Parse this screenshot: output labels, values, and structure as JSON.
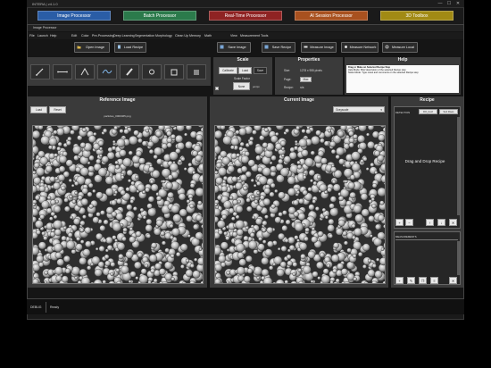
{
  "launcher": {
    "title": "INTERA | v4.1.0",
    "window_controls": [
      "—",
      "☐",
      "✕"
    ],
    "tabs": [
      {
        "label": "Image Processor",
        "color": "#2a5da6"
      },
      {
        "label": "Batch Processor",
        "color": "#2b7a4b"
      },
      {
        "label": "Real-Time Processor",
        "color": "#8f2323"
      },
      {
        "label": "AI Session Processor",
        "color": "#a8511f"
      },
      {
        "label": "3D Toolbox",
        "color": "#a18a14"
      }
    ]
  },
  "app": {
    "title": "Image Processor",
    "menu": [
      "File",
      "Launch",
      "Help",
      "Edit",
      "Color",
      "Pre-Processing",
      "Deep Learning",
      "Segmentation",
      "Morphology",
      "Clean Up",
      "Memory",
      "Math",
      "View",
      "Measurement",
      "Tools"
    ],
    "toolbar": {
      "open_image": "Open Image",
      "load_recipe": "Load Recipe",
      "save_image": "Save Image",
      "save_recipe": "Save Recipe",
      "measure_image": "Measure Image",
      "measure_network": "Measure Network",
      "measure_local": "Measure Local"
    },
    "scale": {
      "header": "Scale",
      "calibrate": "Calibrate",
      "load": "Load",
      "save": "Save",
      "scale_factor_label": "Scale Factor",
      "scale_factor_value": "None",
      "units": "µm/px"
    },
    "properties": {
      "header": "Properties",
      "size_label": "Size:",
      "size_value": "1278 x 955 pixels",
      "page_label": "Page:",
      "page_value": "Max",
      "recipe_label": "Recipe:",
      "recipe_value": "n/a"
    },
    "help": {
      "header": "Help",
      "title_line": "Drag or Make an Selected Recipe Step",
      "lines": [
        "Help Mode:   Brief description of the selected Recipe step",
        "Notes Mode:   Type notes and comments on the selected Recipe step"
      ]
    },
    "reference": {
      "header": "Reference Image",
      "load": "Load",
      "reset": "Reset",
      "filename": "particles_0000465.png"
    },
    "current": {
      "header": "Current Image",
      "view_select": "Grayscale"
    },
    "recipe": {
      "header": "Recipe",
      "detection_label": "DETECTION",
      "tab_off": "DO_Conf",
      "tab_on": "Sort Rows",
      "drop_text": "Drag and Drop Recipe",
      "measurements_label": "MEASUREMENTS"
    },
    "status": {
      "left": "DEBUG",
      "right": "Ready"
    }
  },
  "icons": [
    "pen-icon",
    "line-icon",
    "angle-icon",
    "spline-icon",
    "brush-icon",
    "fill-icon",
    "clear-icon",
    "eraser-icon"
  ]
}
